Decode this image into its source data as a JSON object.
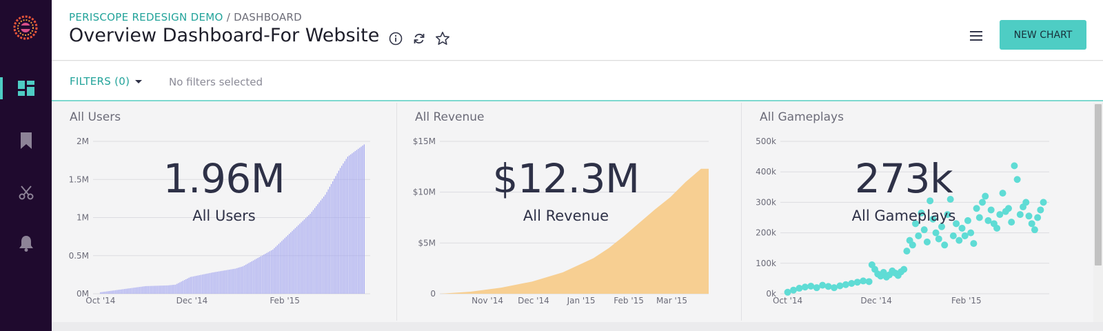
{
  "breadcrumb": {
    "project": "PERISCOPE REDESIGN DEMO",
    "separator": "/",
    "current": "DASHBOARD"
  },
  "page_title": "Overview Dashboard-For Website",
  "toolbar": {
    "new_chart_label": "NEW CHART"
  },
  "icons": [
    "logo-icon",
    "dashboard-icon",
    "bookmark-icon",
    "scissors-icon",
    "bell-icon",
    "info-icon",
    "refresh-icon",
    "star-icon",
    "menu-icon",
    "caret-down-icon"
  ],
  "filters": {
    "label": "FILTERS (0)",
    "status": "No filters selected"
  },
  "colors": {
    "accent": "#4ecdc4",
    "sidebar": "#1f0a2e",
    "users_series": "#9fa2f0",
    "revenue_series": "#f7cf92",
    "gameplays_series": "#5fdcd5"
  },
  "panels": [
    {
      "title": "All Users",
      "big_value": "1.96M",
      "big_label": "All Users"
    },
    {
      "title": "All Revenue",
      "big_value": "$12.3M",
      "big_label": "All Revenue"
    },
    {
      "title": "All Gameplays",
      "big_value": "273k",
      "big_label": "All Gameplays"
    }
  ],
  "chart_data": [
    {
      "type": "bar",
      "title": "All Users",
      "xlabel": "",
      "ylabel": "",
      "ylim": [
        0,
        2000000
      ],
      "y_ticks": [
        {
          "value": 0,
          "label": "0M"
        },
        {
          "value": 500000,
          "label": "0.5M"
        },
        {
          "value": 1000000,
          "label": "1M"
        },
        {
          "value": 1500000,
          "label": "1.5M"
        },
        {
          "value": 2000000,
          "label": "2M"
        }
      ],
      "x_ticks": [
        {
          "x": 0,
          "label": "Oct '14"
        },
        {
          "x": 61,
          "label": "Dec '14"
        },
        {
          "x": 123,
          "label": "Feb '15"
        }
      ],
      "x_range": [
        -5,
        180
      ],
      "x": [
        0,
        30,
        45,
        50,
        60,
        75,
        90,
        95,
        115,
        140,
        150,
        160,
        165,
        176
      ],
      "values": [
        20000,
        100000,
        110000,
        120000,
        220000,
        280000,
        330000,
        360000,
        580000,
        1050000,
        1300000,
        1650000,
        1800000,
        1960000
      ],
      "grid": true
    },
    {
      "type": "area",
      "title": "All Revenue",
      "xlabel": "",
      "ylabel": "",
      "ylim": [
        0,
        15000000
      ],
      "y_ticks": [
        {
          "value": 0,
          "label": "0"
        },
        {
          "value": 5000000,
          "label": "$5M"
        },
        {
          "value": 10000000,
          "label": "$10M"
        },
        {
          "value": 15000000,
          "label": "$15M"
        }
      ],
      "x_ticks": [
        {
          "x": 31,
          "label": "Nov '14"
        },
        {
          "x": 61,
          "label": "Dec '14"
        },
        {
          "x": 92,
          "label": "Jan '15"
        },
        {
          "x": 123,
          "label": "Feb '15"
        },
        {
          "x": 151,
          "label": "Mar '15"
        }
      ],
      "x_range": [
        0,
        175
      ],
      "x": [
        0,
        20,
        40,
        60,
        80,
        100,
        110,
        120,
        130,
        140,
        150,
        160,
        170,
        175
      ],
      "values": [
        0,
        200000,
        600000,
        1200000,
        2100000,
        3500000,
        4500000,
        5700000,
        7000000,
        8300000,
        9500000,
        11000000,
        12300000,
        12300000
      ],
      "grid": true
    },
    {
      "type": "scatter",
      "title": "All Gameplays",
      "xlabel": "",
      "ylabel": "",
      "ylim": [
        0,
        500000
      ],
      "y_ticks": [
        {
          "value": 0,
          "label": "0k"
        },
        {
          "value": 100000,
          "label": "100k"
        },
        {
          "value": 200000,
          "label": "200k"
        },
        {
          "value": 300000,
          "label": "300k"
        },
        {
          "value": 400000,
          "label": "400k"
        },
        {
          "value": 500000,
          "label": "500k"
        }
      ],
      "x_ticks": [
        {
          "x": 0,
          "label": "Oct '14"
        },
        {
          "x": 61,
          "label": "Dec '14"
        },
        {
          "x": 123,
          "label": "Feb '15"
        }
      ],
      "x_range": [
        -5,
        180
      ],
      "x": [
        0,
        4,
        8,
        12,
        16,
        20,
        24,
        28,
        32,
        36,
        40,
        44,
        48,
        52,
        56,
        58,
        60,
        62,
        64,
        66,
        68,
        70,
        72,
        74,
        76,
        78,
        80,
        82,
        84,
        86,
        88,
        90,
        92,
        94,
        96,
        98,
        100,
        102,
        104,
        106,
        108,
        110,
        112,
        114,
        116,
        118,
        120,
        122,
        124,
        126,
        128,
        130,
        132,
        134,
        136,
        138,
        140,
        142,
        144,
        146,
        148,
        150,
        152,
        154,
        156,
        158,
        160,
        162,
        164,
        166,
        168,
        170,
        172,
        174,
        176
      ],
      "values": [
        5000,
        12000,
        18000,
        22000,
        25000,
        20000,
        28000,
        24000,
        20000,
        26000,
        30000,
        34000,
        38000,
        42000,
        40000,
        95000,
        80000,
        65000,
        58000,
        70000,
        55000,
        62000,
        75000,
        68000,
        60000,
        72000,
        80000,
        140000,
        175000,
        160000,
        230000,
        190000,
        265000,
        210000,
        170000,
        305000,
        245000,
        200000,
        180000,
        220000,
        160000,
        260000,
        310000,
        190000,
        230000,
        175000,
        215000,
        190000,
        240000,
        200000,
        165000,
        280000,
        250000,
        300000,
        320000,
        240000,
        275000,
        230000,
        215000,
        260000,
        330000,
        270000,
        280000,
        235000,
        420000,
        375000,
        260000,
        285000,
        300000,
        255000,
        230000,
        210000,
        250000,
        275000,
        300000
      ],
      "grid": true
    }
  ]
}
